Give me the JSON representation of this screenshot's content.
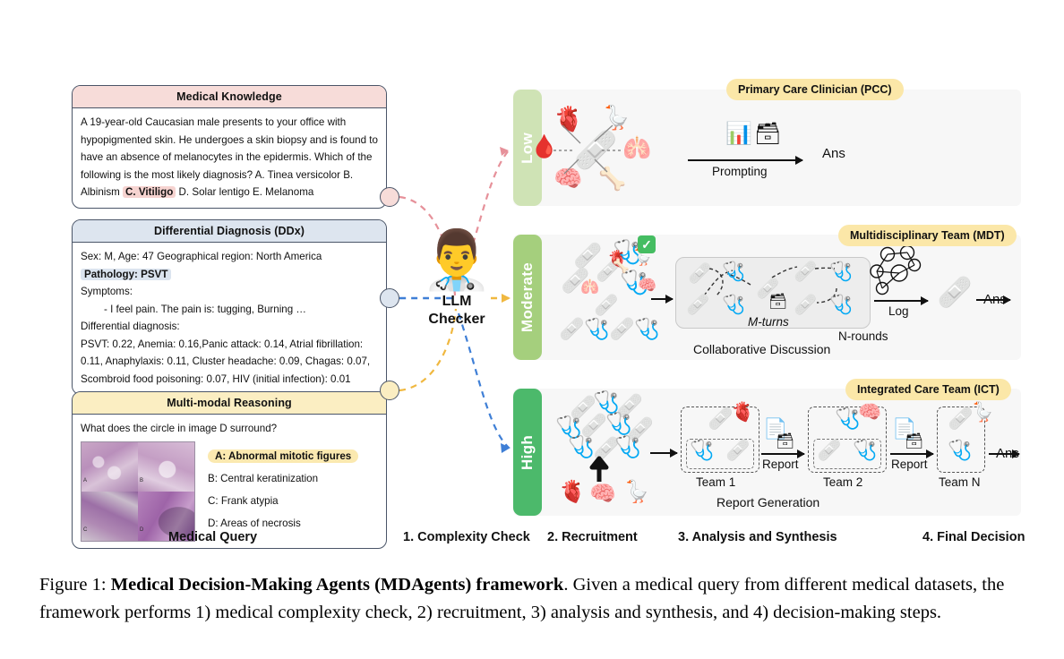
{
  "figure": {
    "caption_prefix": "Figure 1: ",
    "caption_bold": "Medical Decision-Making Agents (MDAgents) framework",
    "caption_rest": ". Given a medical query from different medical datasets, the framework performs 1) medical complexity check, 2) recruitment, 3) analysis and synthesis, and 4) decision-making steps."
  },
  "queries": [
    {
      "title": "Medical Knowledge",
      "header_color": "#f7dcd9",
      "text_before": "A 19-year-old Caucasian male presents to your office with hypopigmented skin. He undergoes a skin biopsy and is found to have an absence of melanocytes in the epidermis. Which of the following is the most likely diagnosis? A. Tinea versicolor B. Albinism ",
      "highlight": "C. Vitiligo",
      "text_after": " D. Solar lentigo E. Melanoma"
    },
    {
      "title": "Differential Diagnosis (DDx)",
      "header_color": "#dde5ef",
      "line1": "Sex: M, Age: 47 Geographical region: North America",
      "highlight": "Pathology: PSVT",
      "line3": "Symptoms:",
      "line4": "- I feel pain. The pain is: tugging, Burning …",
      "line5": "Differential diagnosis:",
      "line6": "PSVT: 0.22, Anemia: 0.16,Panic attack: 0.14, Atrial fibrillation:",
      "line7": "0.11, Anaphylaxis: 0.11, Cluster headache: 0.09, Chagas: 0.07,",
      "line8": "Scombroid food poisoning: 0.07, HIV (initial infection): 0.01"
    },
    {
      "title": "Multi-modal Reasoning",
      "header_color": "#fbeec2",
      "question": "What does the circle in image D surround?",
      "options": [
        "A: Abnormal mitotic figures",
        "B: Central keratinization",
        "C: Frank atypia",
        "D: Areas of necrosis"
      ],
      "image_tile_labels": [
        "A",
        "B",
        "C",
        "D"
      ]
    }
  ],
  "checker": {
    "icon": "doctor-with-clipboard",
    "label_line1": "LLM",
    "label_line2": "Checker"
  },
  "complexity_rows": [
    {
      "level": "Low",
      "bar_color": "#cfe3b5",
      "badge": "Primary Care Clinician (PCC)",
      "process_label": "Prompting",
      "answer": "Ans",
      "organs": [
        "heart",
        "kidneys",
        "lungs",
        "blood-drop",
        "brain",
        "bone"
      ],
      "tools": [
        "dashboard-icon",
        "database-icon"
      ]
    },
    {
      "level": "Moderate",
      "bar_color": "#a5cf7d",
      "badge": "Multidisciplinary Team (MDT)",
      "box_label": "M-turns",
      "box_caption": "Collaborative Discussion",
      "rounds_label": "N-rounds",
      "process_label": "Log",
      "answer": "Ans",
      "check_icon": "check-mark-icon"
    },
    {
      "level": "High",
      "bar_color": "#4cb96b",
      "badge": "Integrated Care Team (ICT)",
      "teams": [
        "Team 1",
        "Team 2",
        "Team N"
      ],
      "report_labels": [
        "Report",
        "Report"
      ],
      "caption": "Report Generation",
      "answer": "Ans",
      "organs": [
        "heart",
        "brain",
        "kidneys"
      ]
    }
  ],
  "stage_labels": [
    "Medical Query",
    "1. Complexity Check",
    "2. Recruitment",
    "3. Analysis and Synthesis",
    "4. Final Decision"
  ]
}
